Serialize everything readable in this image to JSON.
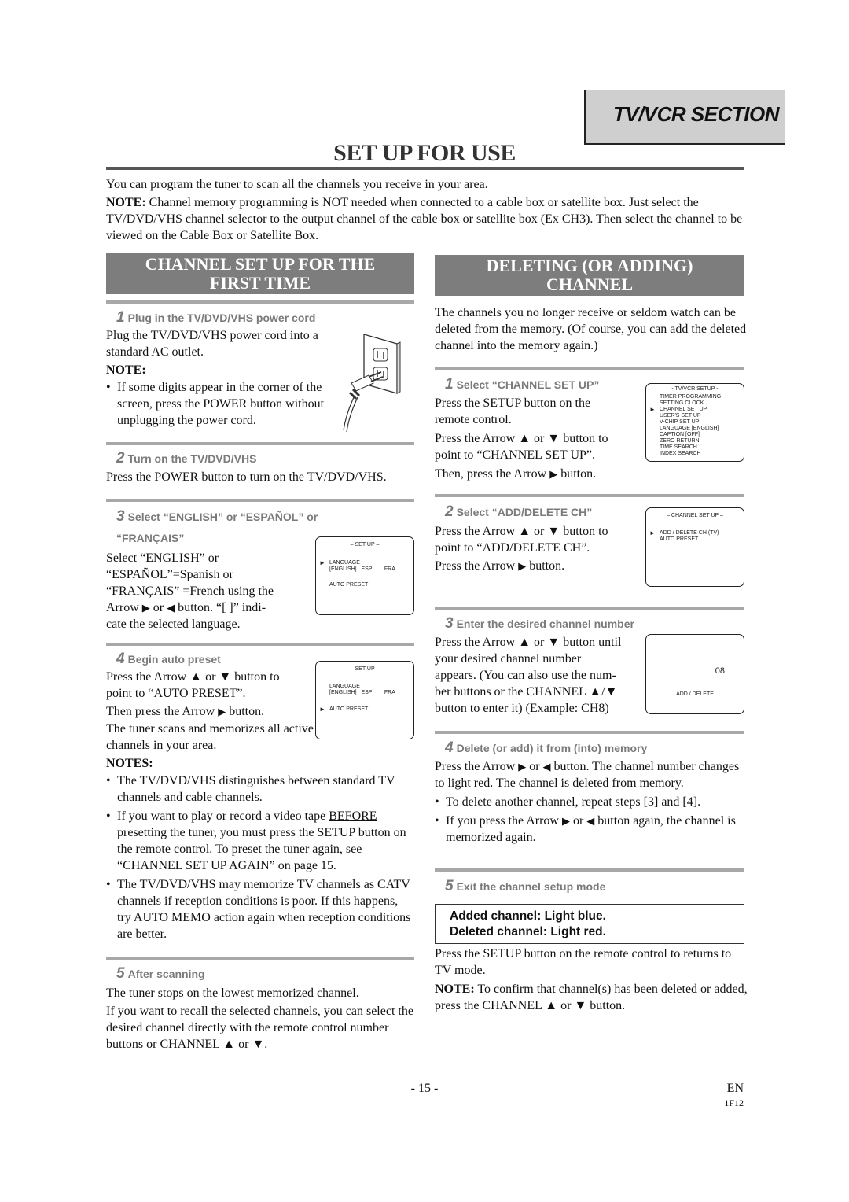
{
  "header": {
    "section_tab": "TV/VCR SECTION",
    "page_title": "SET UP FOR USE"
  },
  "intro": {
    "line1": "You can program the tuner to scan all the channels you receive in your area.",
    "note_label": "NOTE:",
    "note_text": " Channel memory programming is NOT needed when connected to a cable box or satellite box. Just select the TV/DVD/VHS channel selector to the output channel of the cable box or satellite box (Ex CH3). Then select the channel to be viewed on the Cable Box or Satellite Box."
  },
  "left": {
    "banner_line1": "CHANNEL SET UP FOR THE",
    "banner_line2": "FIRST TIME",
    "step1": {
      "num": "1",
      "title": "Plug in the TV/DVD/VHS power cord",
      "body": "Plug the TV/DVD/VHS power cord into a standard AC outlet.",
      "note_label": "NOTE:",
      "note_bullet": "If some digits appear in the corner of the screen, press the POWER button without unplugging the power cord.",
      "illustration": "power-outlet-plug-icon"
    },
    "step2": {
      "num": "2",
      "title": "Turn on the TV/DVD/VHS",
      "body": "Press the POWER button to turn on the TV/DVD/VHS."
    },
    "step3": {
      "num": "3",
      "title_line1": "Select “ENGLISH” or “ESPAÑOL” or",
      "title_line2": "“FRANÇAIS”",
      "body_l1": "Select “ENGLISH” or",
      "body_l2": "“ESPAÑOL”=Spanish or",
      "body_l3": "“FRANÇAIS” =French using the",
      "body_l4a": "Arrow ",
      "body_l4b": " or ",
      "body_l4c": " button. “[ ]” indi-",
      "body_l5": "cate the selected language.",
      "screen": {
        "title": "– SET UP –",
        "item1": "LANGUAGE",
        "item1_options": "[ENGLISH]   ESP        FRA",
        "item2": "AUTO PRESET",
        "pointer_on": "LANGUAGE"
      }
    },
    "step4": {
      "num": "4",
      "title": "Begin auto preset",
      "body_l1a": "Press the Arrow ",
      "body_l1b": " or ",
      "body_l1c": " button to",
      "body_l2": "point to “AUTO PRESET”.",
      "body_l3a": "Then press the Arrow ",
      "body_l3b": " button.",
      "body_l4": "The tuner scans and memorizes all active channels in your area.",
      "screen": {
        "title": "– SET UP –",
        "item1": "LANGUAGE",
        "item1_options": "[ENGLISH]   ESP        FRA",
        "item2": "AUTO PRESET",
        "pointer_on": "AUTO PRESET"
      }
    },
    "notes": {
      "label": "NOTES:",
      "n1": "The TV/DVD/VHS distinguishes between standard TV channels and cable channels.",
      "n2_a": "If you want to play or record a video tape ",
      "n2_u": "BEFORE",
      "n2_b": " presetting the tuner, you must press the SETUP button on the remote control. To preset the tuner again, see “CHANNEL SET UP AGAIN” on page 15.",
      "n3": "The TV/DVD/VHS may memorize TV channels as CATV channels if reception conditions is poor. If this happens, try AUTO MEMO action again when reception conditions are better."
    },
    "step5": {
      "num": "5",
      "title": "After scanning",
      "body1": "The tuner stops on the lowest memorized channel.",
      "body2": "If you want to recall the selected channels, you can select the desired channel directly with the remote control number buttons or CHANNEL ▲ or ▼."
    }
  },
  "right": {
    "banner_line1": "DELETING (OR ADDING)",
    "banner_line2": "CHANNEL",
    "intro": "The channels you no longer receive or seldom watch can be deleted from the memory. (Of course, you can add the deleted channel into the memory again.)",
    "step1": {
      "num": "1",
      "title": "Select “CHANNEL SET UP”",
      "body_l1": "Press the SETUP button on the",
      "body_l2": "remote control.",
      "body_l3": "Press the Arrow ▲ or ▼ button to",
      "body_l4": "point to “CHANNEL SET UP”.",
      "body_l5a": "Then, press the Arrow ",
      "body_l5b": " button.",
      "screen": {
        "title": "- TV/VCR SETUP -",
        "items": [
          "TIMER PROGRAMMING",
          "SETTING CLOCK",
          "CHANNEL SET UP",
          "USER'S SET UP",
          "V-CHIP SET UP",
          "LANGUAGE  [ENGLISH]",
          "CAPTION  [OFF]",
          "ZERO RETURN",
          "TIME SEARCH",
          "INDEX SEARCH"
        ],
        "pointer_on": "CHANNEL SET UP"
      }
    },
    "step2": {
      "num": "2",
      "title": "Select “ADD/DELETE CH”",
      "body_l1": "Press the Arrow ▲ or ▼ button to",
      "body_l2": "point to “ADD/DELETE CH”.",
      "body_l3a": "Press the Arrow ",
      "body_l3b": " button.",
      "screen": {
        "title": "– CHANNEL SET UP –",
        "items": [
          "ADD / DELETE CH (TV)",
          "AUTO PRESET"
        ],
        "pointer_on": "ADD / DELETE CH (TV)"
      }
    },
    "step3": {
      "num": "3",
      "title": "Enter the desired channel number",
      "body_l1": "Press the Arrow ▲ or ▼ button until",
      "body_l2": "your desired channel number",
      "body_l3": "appears. (You can also use the num-",
      "body_l4": "ber buttons  or the CHANNEL ▲/▼",
      "body_l5": "button to enter it) (Example: CH8)",
      "screen": {
        "channel": "08",
        "label": "ADD / DELETE"
      }
    },
    "step4": {
      "num": "4",
      "title": "Delete (or add) it from (into) memory",
      "body_a": "Press the Arrow ",
      "body_b": " or ",
      "body_c": " button. The channel number changes to light red. The channel is deleted from memory.",
      "b1": "To delete another channel, repeat steps [3] and [4].",
      "b2_a": "If you press the Arrow ",
      "b2_b": " or ",
      "b2_c": " button again, the channel is memorized again."
    },
    "step5": {
      "num": "5",
      "title": "Exit the channel setup mode",
      "box_l1": "Added channel: Light blue.",
      "box_l2": "Deleted channel: Light red.",
      "body": "Press the SETUP button on the remote control to returns to TV mode.",
      "note_label": "NOTE:",
      "note_text": " To confirm that channel(s) has been deleted or added, press the CHANNEL ▲ or ▼ button."
    }
  },
  "footer": {
    "page_number": "- 15 -",
    "lang": "EN",
    "code": "1F12"
  },
  "icons": {
    "arrow_right": "▶",
    "arrow_left": "◀",
    "pointer": "►"
  }
}
